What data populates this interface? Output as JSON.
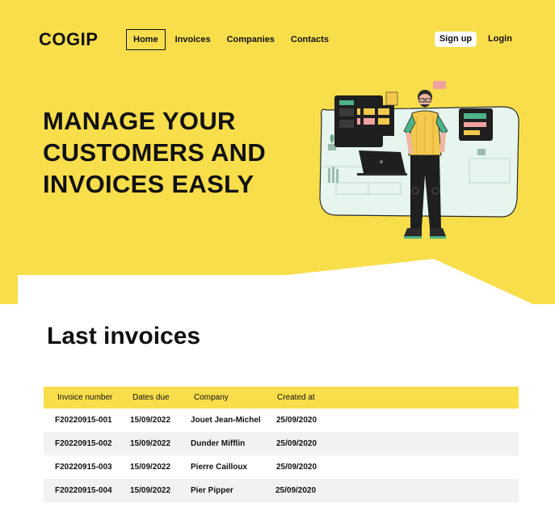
{
  "brand": "COGIP",
  "nav": {
    "items": [
      {
        "label": "Home",
        "active": true
      },
      {
        "label": "Invoices"
      },
      {
        "label": "Companies"
      },
      {
        "label": "Contacts"
      }
    ],
    "signup": "Sign up",
    "login": "Login"
  },
  "hero": {
    "title_lines": [
      "MANAGE YOUR",
      "CUSTOMERS AND",
      "INVOICES EASLY"
    ],
    "illustration": "person-with-dashboard-screens-illustration"
  },
  "invoices": {
    "title": "Last invoices",
    "columns": [
      "Invoice number",
      "Dates due",
      "Company",
      "Created at"
    ],
    "rows": [
      [
        "F20220915-001",
        "15/09/2022",
        "Jouet Jean-Michel",
        "25/09/2020"
      ],
      [
        "F20220915-002",
        "15/09/2022",
        "Dunder Mifflin",
        "25/09/2020"
      ],
      [
        "F20220915-003",
        "15/09/2022",
        "Pierre Cailloux",
        "25/09/2020"
      ],
      [
        "F20220915-004",
        "15/09/2022",
        "Pier Pipper",
        "25/09/2020"
      ]
    ]
  },
  "colors": {
    "accent": "#F9DE4B",
    "row_alt": "#F2F2F2",
    "text": "#111111"
  }
}
